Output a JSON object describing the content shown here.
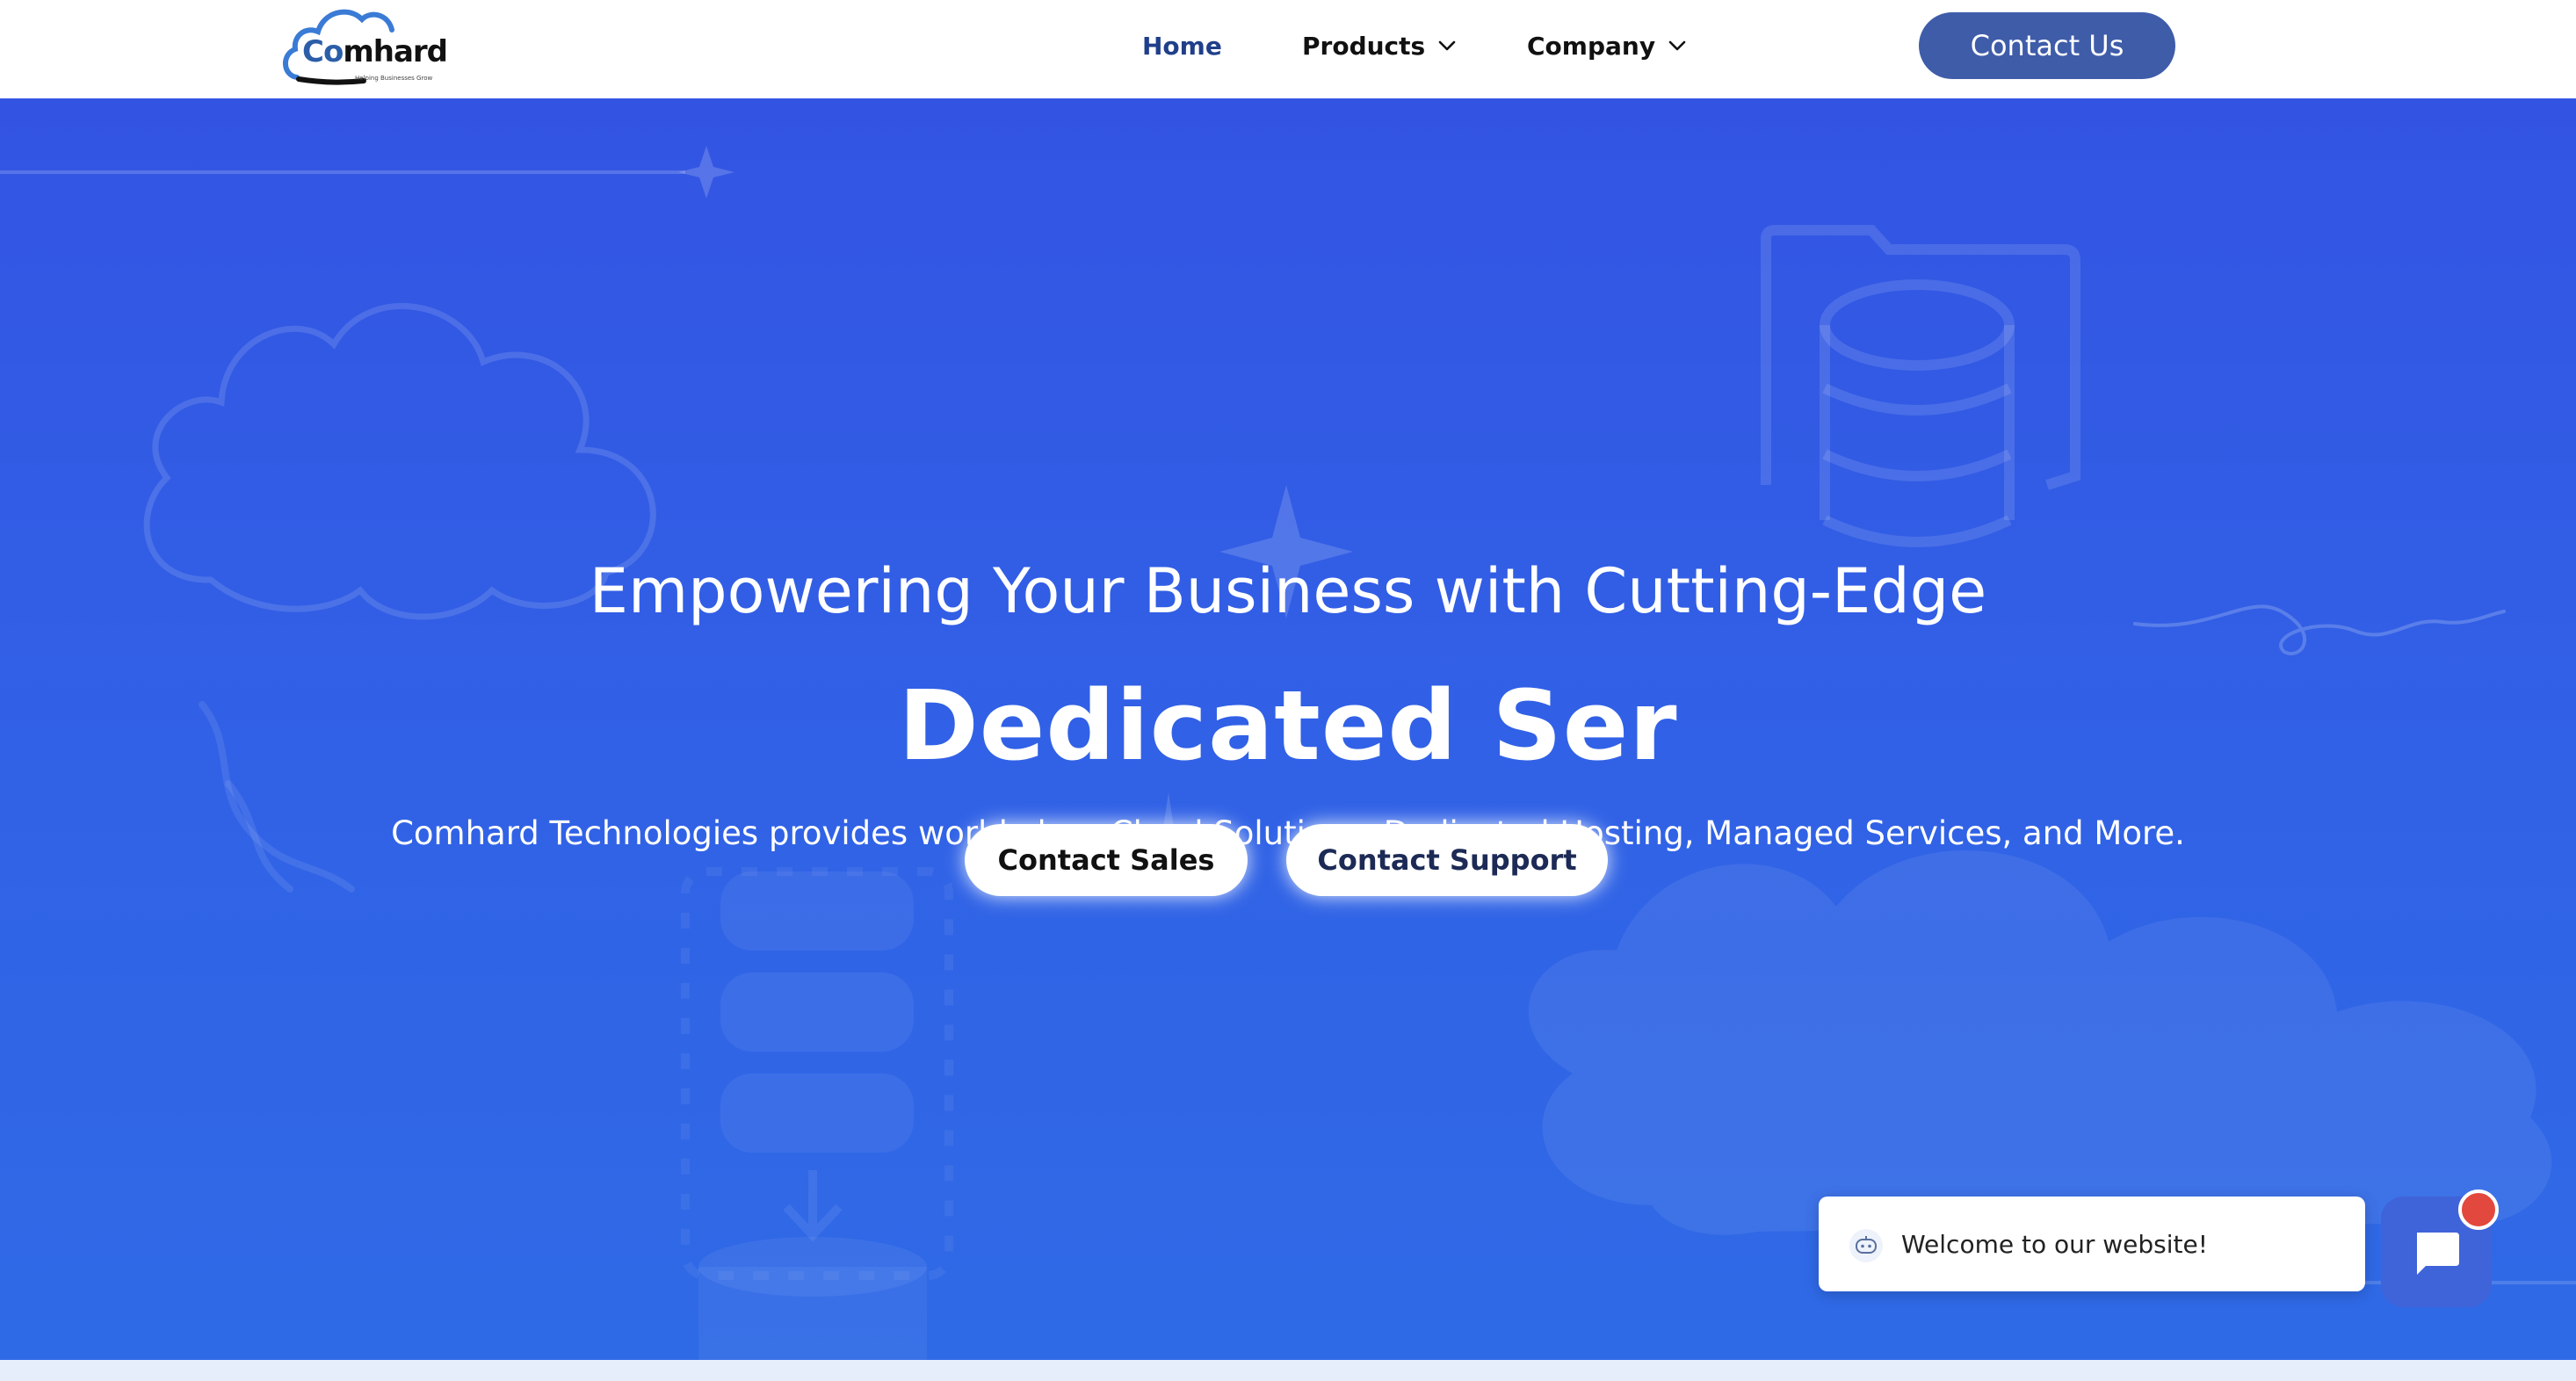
{
  "brand": {
    "logo_prefix": "Co",
    "logo_suffix": "mhard",
    "tagline": "Helping Businesses Grow",
    "icon": "cloud-logo-icon",
    "color": "#2b5ea8"
  },
  "nav": {
    "items": [
      {
        "label": "Home",
        "active": true
      },
      {
        "label": "Products",
        "has_dropdown": true,
        "icon": "chevron-down-icon"
      },
      {
        "label": "Company",
        "has_dropdown": true,
        "icon": "chevron-down-icon"
      }
    ],
    "cta_label": "Contact Us",
    "cta_color": "#3f5ca9",
    "active_color": "#1f3f8a"
  },
  "hero": {
    "heading": "Empowering Your Business with Cutting-Edge",
    "typed_text": "Dedicated Ser",
    "subheading": "Comhard Technologies provides world-class Cloud Solutions, Dedicated Hosting, Managed Services, and More.",
    "buttons": [
      {
        "label": "Contact Sales"
      },
      {
        "label": "Contact Support"
      }
    ],
    "background_color": "#3358e4",
    "decorative_icons": [
      "cloud-outline-icon",
      "database-folder-icon",
      "sparkle-icon",
      "server-rack-icon",
      "cloud-filled-icon"
    ]
  },
  "chat": {
    "welcome_message": "Welcome to our website!",
    "bot_icon": "chatbot-icon",
    "launcher_icon": "chat-bubble-icon",
    "launcher_color": "#3f63d8",
    "notification_color": "#e2483d"
  }
}
